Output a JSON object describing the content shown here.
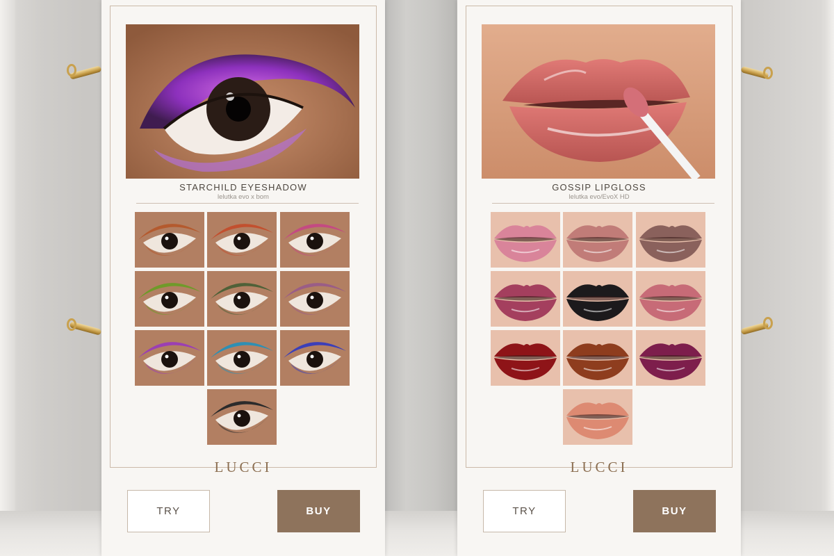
{
  "products": [
    {
      "title": "STARCHILD EYESHADOW",
      "subtitle": "lelutka evo x bom",
      "brand": "LUCCI",
      "try_label": "TRY",
      "buy_label": "BUY",
      "swatch_colors": [
        "#b45a2e",
        "#c2502f",
        "#c44a82",
        "#6f9a2a",
        "#4f6138",
        "#9a5d86",
        "#9b3fb3",
        "#2f8fb3",
        "#3c3fb8",
        "#2b2b2b"
      ]
    },
    {
      "title": "GOSSIP LIPGLOSS",
      "subtitle": "lelutka evo/EvoX HD",
      "brand": "LUCCI",
      "try_label": "TRY",
      "buy_label": "BUY",
      "swatch_colors": [
        "#d9849a",
        "#c17c78",
        "#8a615c",
        "#a43f5e",
        "#1c1a1c",
        "#c76b77",
        "#8e1418",
        "#8e3d1e",
        "#7d1e4c",
        "#dd8a72"
      ]
    }
  ]
}
